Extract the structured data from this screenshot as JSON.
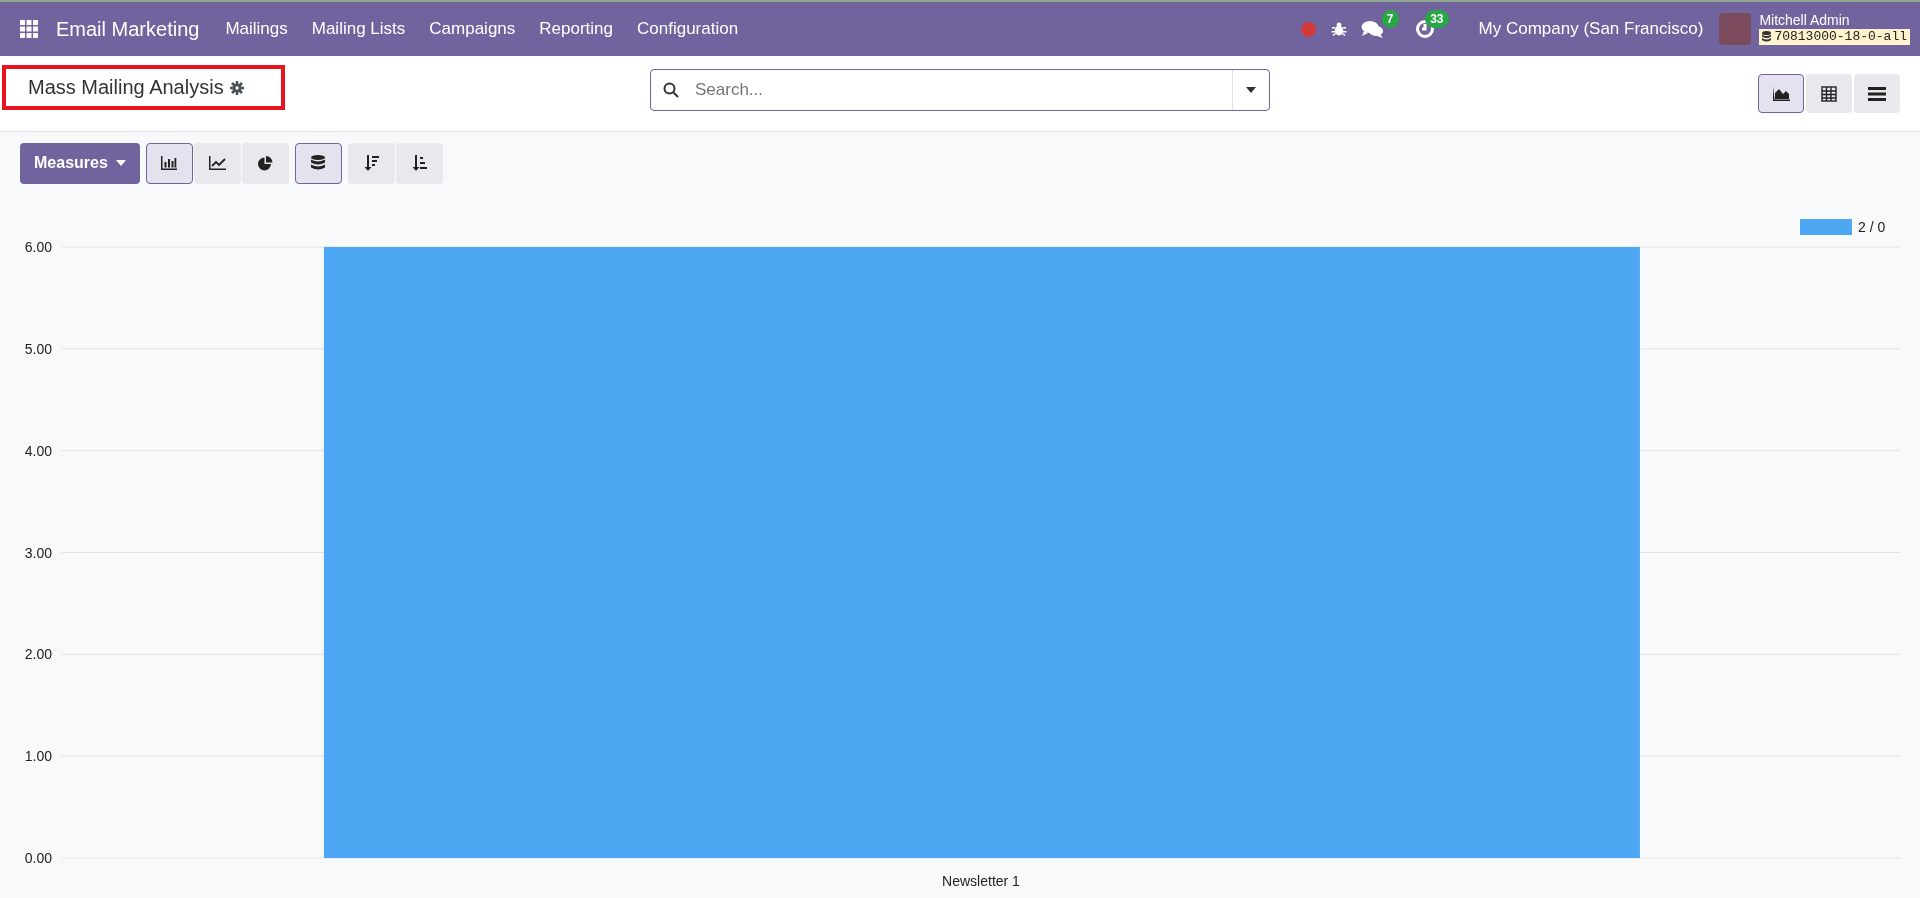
{
  "navbar": {
    "app_name": "Email Marketing",
    "menu": [
      "Mailings",
      "Mailing Lists",
      "Campaigns",
      "Reporting",
      "Configuration"
    ],
    "messages_badge": "7",
    "activities_badge": "33",
    "company": "My Company (San Francisco)",
    "user_name": "Mitchell Admin",
    "database": "70813000-18-0-all"
  },
  "control_panel": {
    "title": "Mass Mailing Analysis",
    "highlighted": true,
    "search": {
      "placeholder": "Search..."
    },
    "views": [
      {
        "kind": "graph",
        "selected": true
      },
      {
        "kind": "pivot",
        "selected": false
      },
      {
        "kind": "list",
        "selected": false
      }
    ]
  },
  "toolbar": {
    "measures_label": "Measures",
    "chart_types": [
      {
        "kind": "bar",
        "selected": true
      },
      {
        "kind": "line",
        "selected": false
      },
      {
        "kind": "pie",
        "selected": false
      }
    ],
    "stacked": {
      "selected": true
    },
    "sort_buttons": [
      {
        "kind": "descending"
      },
      {
        "kind": "ascending"
      }
    ]
  },
  "chart": {
    "chart_data": {
      "type": "bar",
      "categories": [
        "Newsletter 1"
      ],
      "series": [
        {
          "name": "2 / 0",
          "color": "#4ea7f2",
          "values": [
            6
          ]
        }
      ],
      "ylim": [
        0,
        6
      ],
      "grid": true,
      "yticks": [
        {
          "value": 0,
          "label": "0.00"
        },
        {
          "value": 1,
          "label": "1.00"
        },
        {
          "value": 2,
          "label": "2.00"
        },
        {
          "value": 3,
          "label": "3.00"
        },
        {
          "value": 4,
          "label": "4.00"
        },
        {
          "value": 5,
          "label": "5.00"
        },
        {
          "value": 6,
          "label": "6.00"
        }
      ]
    }
  }
}
